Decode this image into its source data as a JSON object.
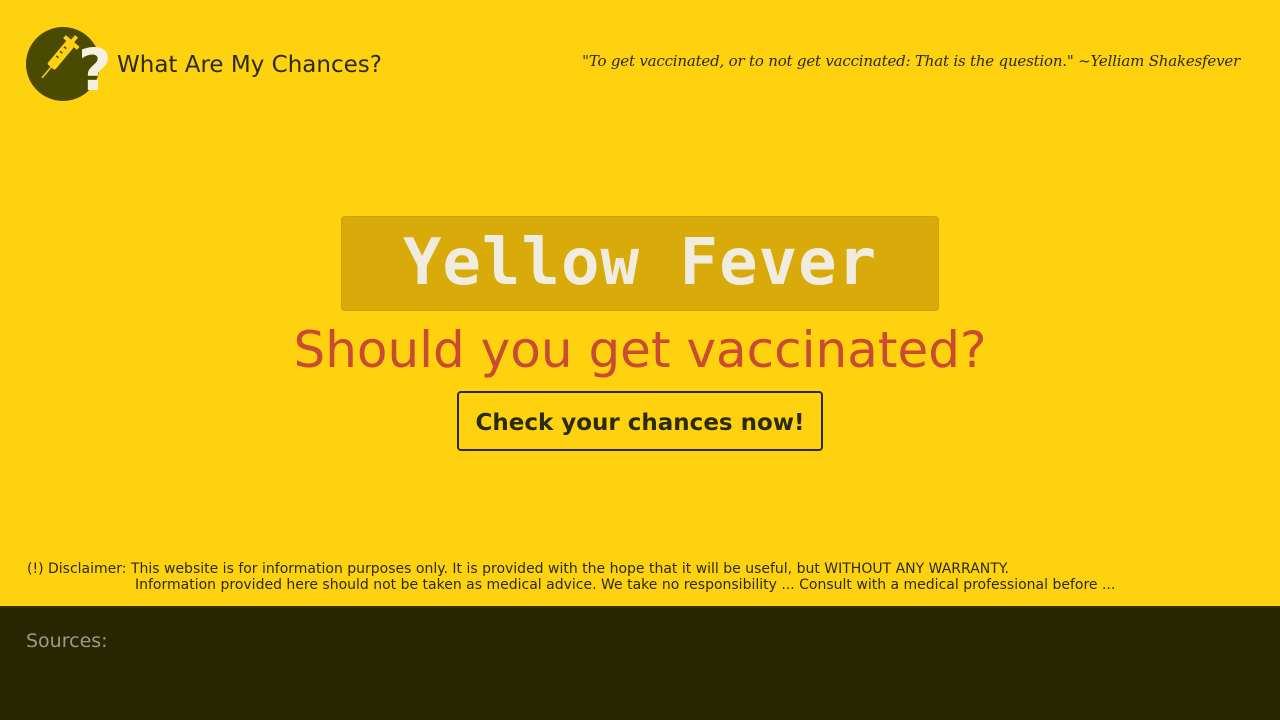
{
  "header": {
    "site_title": "What Are My Chances?",
    "logo_icon": "syringe-question-logo-icon",
    "quote": "\"To get vaccinated, or to not get vaccinated: That is the question.\" ~Yelliam Shakesfever"
  },
  "hero": {
    "disease": "Yellow Fever",
    "question": "Should you get vaccinated?",
    "cta_label": "Check your chances now!"
  },
  "disclaimer": {
    "line1": "(!) Disclaimer: This website is for information purposes only. It is provided with the hope that it will be useful, but WITHOUT ANY WARRANTY.",
    "line2": "Information provided here should not be taken as medical advice. We take no responsibility ... Consult with a medical professional before ..."
  },
  "footer": {
    "sources_label": "Sources:"
  },
  "colors": {
    "background": "#ffd20f",
    "disease_box": "#d8aa0a",
    "question_text": "#c84b32",
    "footer_bg": "#262600",
    "logo_circle": "#4a4a00",
    "logo_question": "#f3f0e0"
  }
}
